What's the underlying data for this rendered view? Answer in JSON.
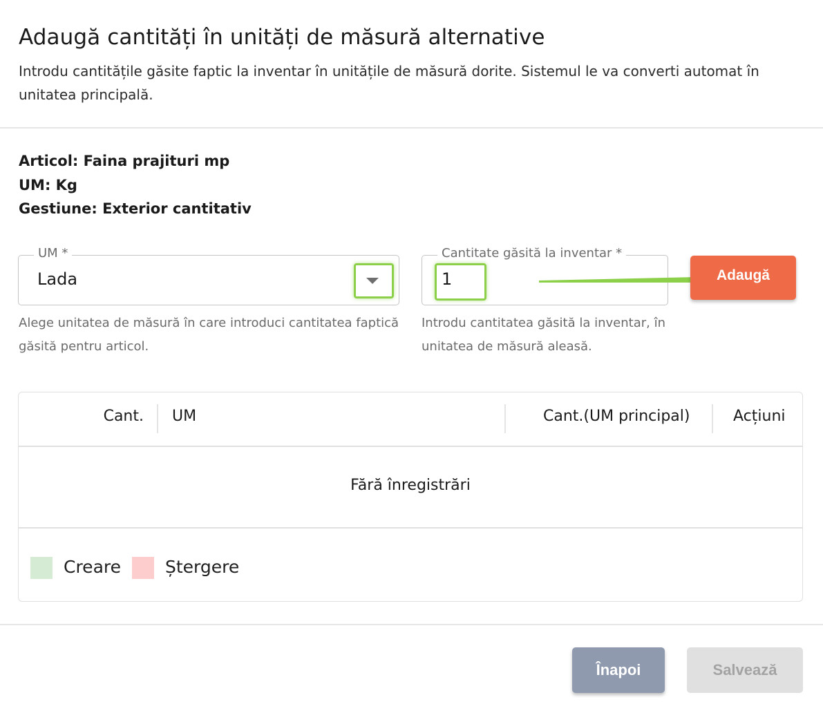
{
  "dialog": {
    "title": "Adaugă cantități în unități de măsură alternative",
    "subtitle": "Introdu cantitățile găsite faptic la inventar în unitățile de măsură dorite. Sistemul le va converti automat în unitatea principală."
  },
  "info": {
    "articol": "Articol: Faina prajituri mp",
    "um": "UM: Kg",
    "gestiune": "Gestiune: Exterior cantitativ"
  },
  "form": {
    "um_label": "UM *",
    "um_value": "Lada",
    "um_helper": "Alege unitatea de măsură în care introduci cantitatea faptică găsită pentru articol.",
    "qty_label": "Cantitate găsită la inventar *",
    "qty_value": "1",
    "qty_helper": "Introdu cantitatea găsită la inventar, în unitatea de măsură aleasă.",
    "add_label": "Adaugă"
  },
  "table": {
    "columns": [
      "Cant.",
      "UM",
      "Cant.(UM principal)",
      "Acțiuni"
    ],
    "empty_message": "Fără înregistrări",
    "legend": [
      {
        "label": "Creare",
        "color": "#d6ebd4"
      },
      {
        "label": "Ștergere",
        "color": "#fdcdcd"
      }
    ]
  },
  "footer": {
    "back_label": "Înapoi",
    "save_label": "Salvează"
  },
  "colors": {
    "accent": "#ef6a47",
    "highlight": "#8cd04a",
    "secondary_button": "#8f9aae",
    "disabled_button": "#e0e0e0"
  }
}
